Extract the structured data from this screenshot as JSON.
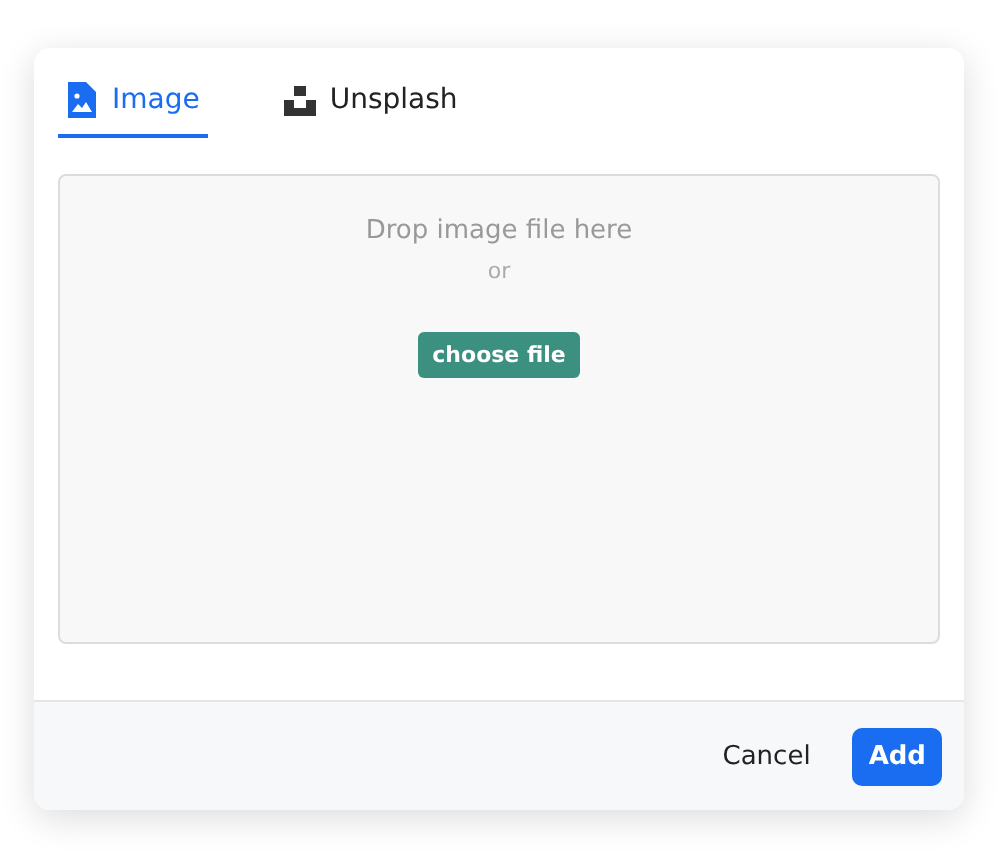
{
  "tabs": [
    {
      "label": "Image",
      "kind": "image",
      "selected": true
    },
    {
      "label": "Unsplash",
      "kind": "unsplash",
      "selected": false
    }
  ],
  "dropzone": {
    "title": "Drop image file here",
    "separator": "or",
    "button": "choose file"
  },
  "footer": {
    "buttons": [
      {
        "label": "Cancel",
        "kind": "secondary"
      },
      {
        "label": "Add",
        "kind": "primary"
      }
    ]
  }
}
